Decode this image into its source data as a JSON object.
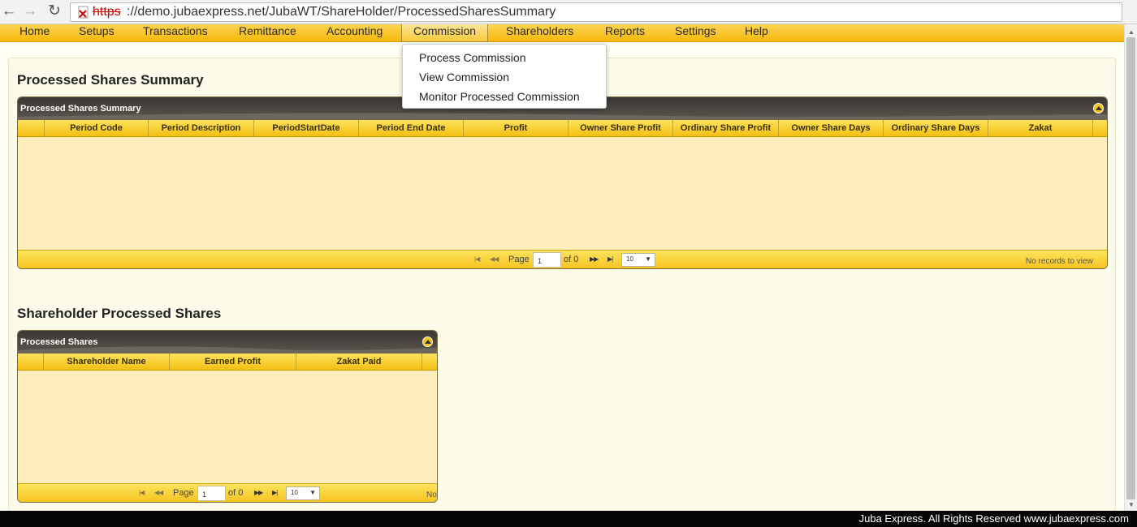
{
  "browser": {
    "url_scheme": "https",
    "url_rest": "://demo.jubaexpress.net/JubaWT/ShareHolder/ProcessedSharesSummary"
  },
  "menu": {
    "items": [
      "Home",
      "Setups",
      "Transactions",
      "Remittance",
      "Accounting",
      "Commission",
      "Shareholders",
      "Reports",
      "Settings",
      "Help"
    ],
    "active": "Commission",
    "dropdown": [
      "Process Commission",
      "View Commission",
      "Monitor Processed Commission"
    ]
  },
  "summary_section": {
    "title": "Processed Shares Summary",
    "grid": {
      "caption": "Processed Shares Summary",
      "columns": [
        "Period Code",
        "Period Description",
        "PeriodStartDate",
        "Period End Date",
        "Profit",
        "Owner Share Profit",
        "Ordinary Share Profit",
        "Owner Share Days",
        "Ordinary Share Days",
        "Zakat"
      ],
      "rows": [],
      "pager": {
        "page_label": "Page",
        "page_value": "1",
        "of_label": "of 0",
        "page_size": "10",
        "records": "No records to view"
      }
    }
  },
  "shareholder_section": {
    "title": "Shareholder Processed Shares",
    "grid": {
      "caption": "Processed Shares",
      "columns": [
        "Shareholder Name",
        "Earned Profit",
        "Zakat Paid"
      ],
      "rows": [],
      "pager": {
        "page_label": "Page",
        "page_value": "1",
        "of_label": "of 0",
        "page_size": "10",
        "records": "No"
      }
    }
  },
  "footer": {
    "text": "Juba Express. All Rights Reserved www.jubaexpress.com"
  },
  "colors": {
    "menu_gold": "#f7b80a",
    "grid_header_gold": "#fde35d",
    "caption_dark": "#3a3733",
    "grid_body": "#fdeebc"
  }
}
